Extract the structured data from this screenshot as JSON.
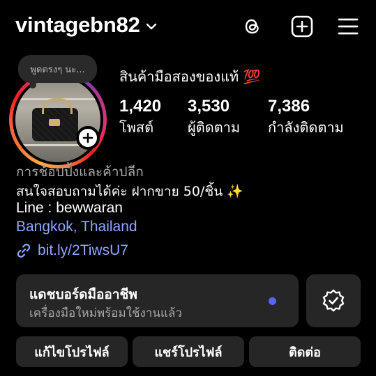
{
  "header": {
    "username": "vintagebn82",
    "icons": [
      "chevron-down-icon",
      "threads-icon",
      "create-plus-icon",
      "menu-icon"
    ]
  },
  "profile": {
    "note": "พูดตรงๆ นะ...",
    "display_name": "สินค้ามือสองของแท้ 💯",
    "stats": [
      {
        "value": "1,420",
        "label": "โพสต์"
      },
      {
        "value": "3,530",
        "label": "ผู้ติดตาม"
      },
      {
        "value": "7,386",
        "label": "กำลังติดตาม"
      }
    ]
  },
  "bio": {
    "category": "การช้อปปิ้งและค้าปลีก",
    "line1": "สนใจสอบถามได้ค่ะ ฝากขาย 50/ชิ้น ✨",
    "line2": "Line : bewwaran",
    "location": "Bangkok, Thailand",
    "link": "bit.ly/2TiwsU7"
  },
  "dashboard": {
    "title": "แดชบอร์ดมืออาชีพ",
    "subtitle": "เครื่องมือใหม่พร้อมใช้งานแล้ว",
    "dot_color": "#5865f2"
  },
  "buttons": {
    "edit_profile": "แก้ไขโปรไฟล์",
    "share_profile": "แชร์โปรไฟล์",
    "contact": "ติดต่อ"
  },
  "colors": {
    "background": "#000000",
    "surface": "#262626",
    "link": "#8fa6ff",
    "secondary_text": "#a8a8a8"
  }
}
